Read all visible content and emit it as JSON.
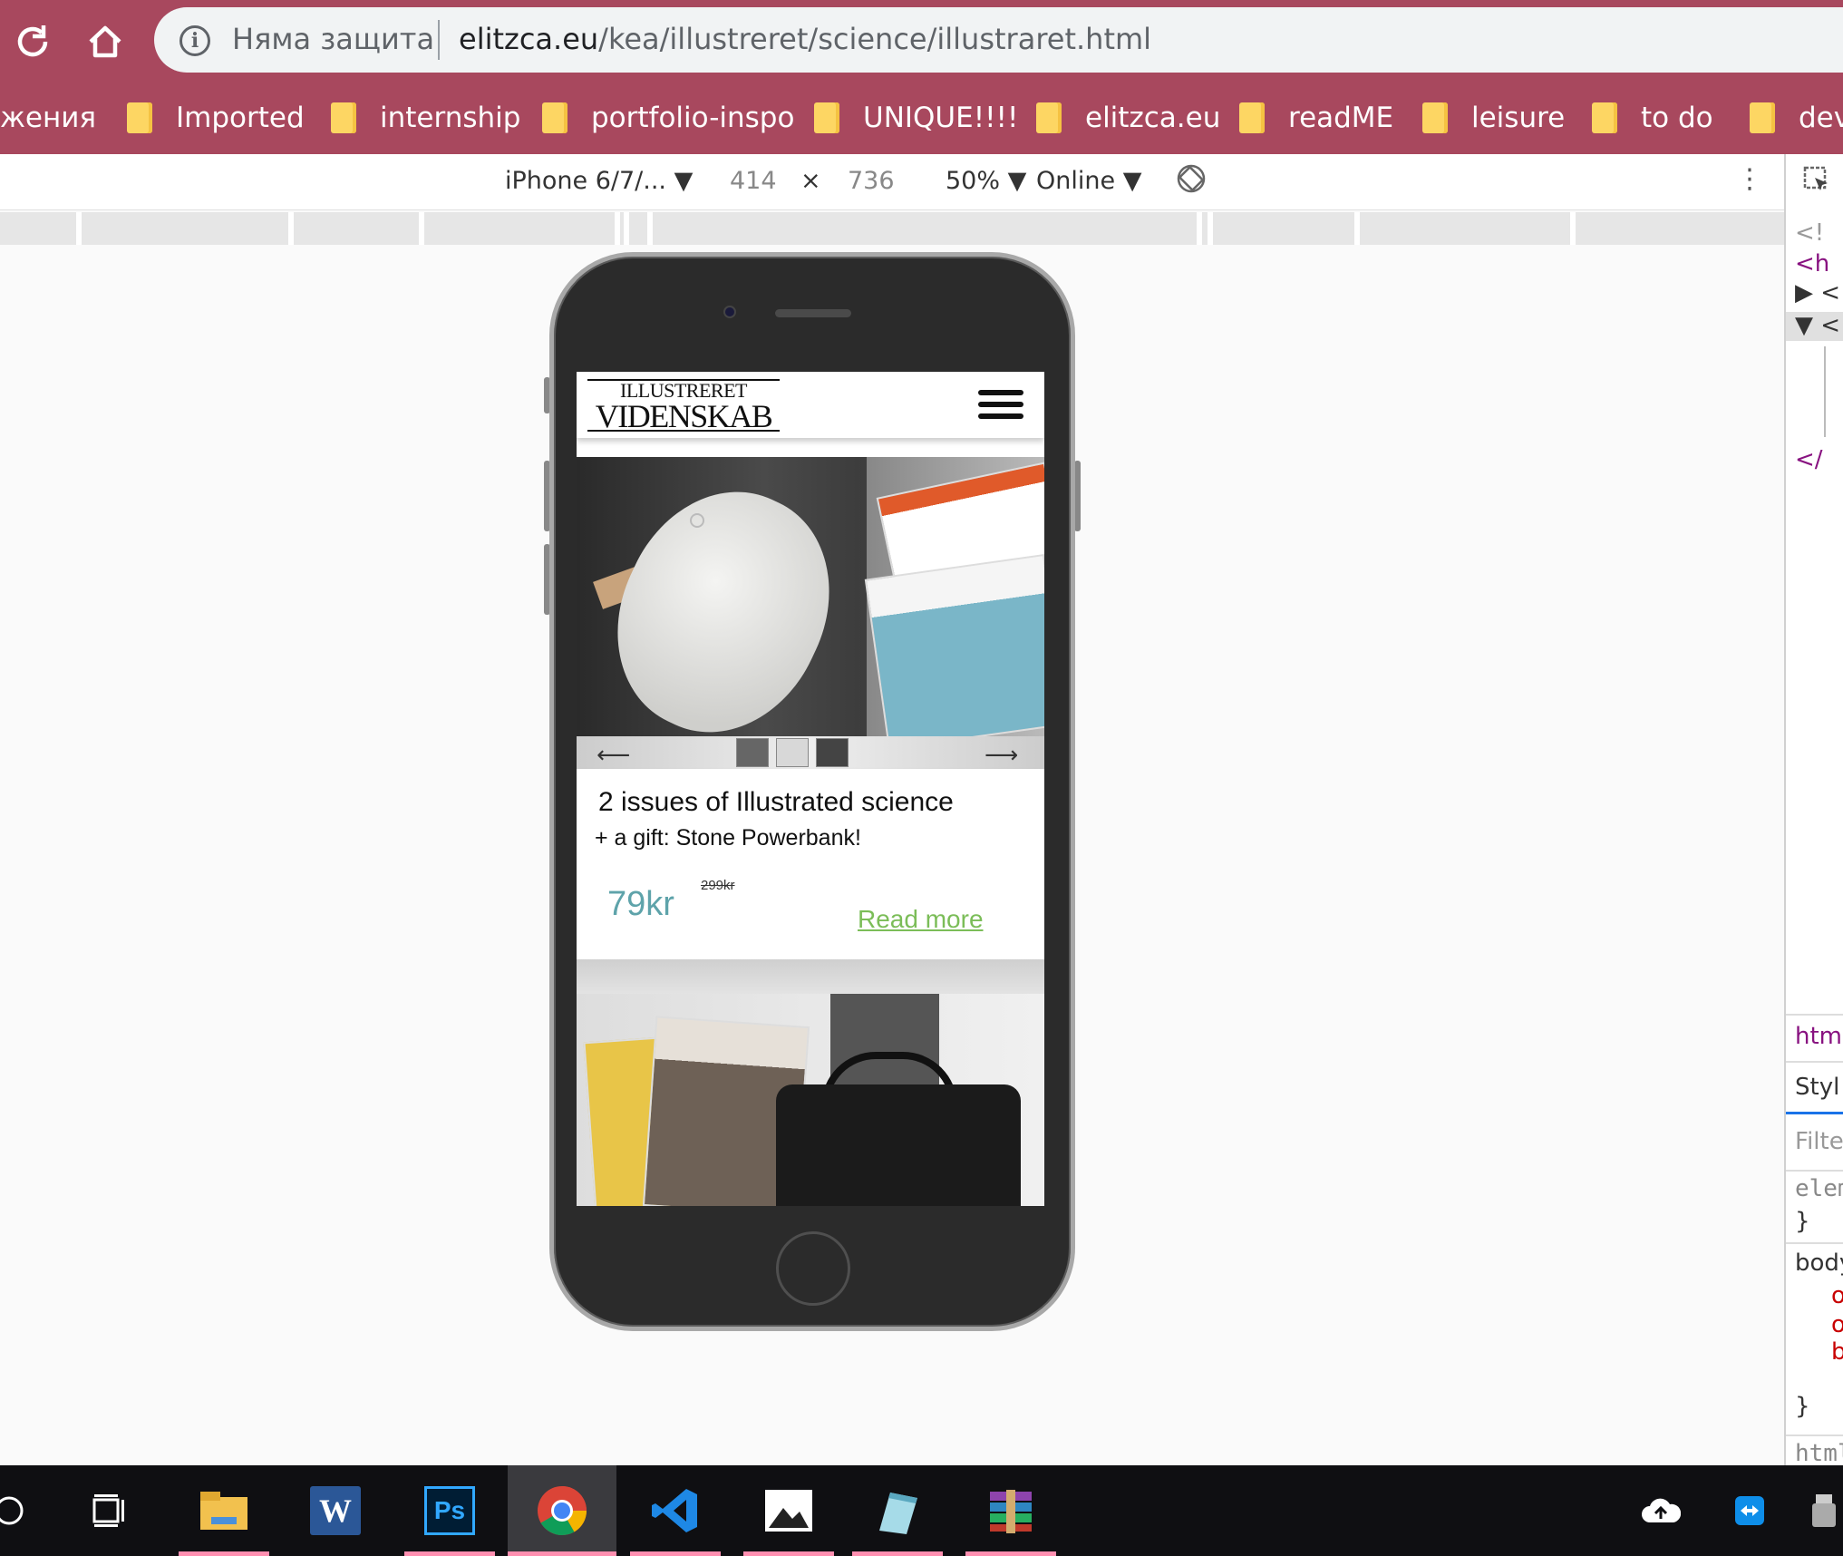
{
  "browser": {
    "security_label": "Няма защита",
    "url_host": "elitzca.eu",
    "url_path": "/kea/illustreret/science/illustraret.html"
  },
  "bookmarks": [
    "жения",
    "Imported",
    "internship",
    "portfolio-inspo",
    "UNIQUE!!!!",
    "elitzca.eu",
    "readME",
    "leisure",
    "to do",
    "dev"
  ],
  "device_toolbar": {
    "device": "iPhone 6/7/...",
    "width": "414",
    "times": "×",
    "height": "736",
    "zoom": "50%",
    "network": "Online"
  },
  "devtools": {
    "elements_lines": [
      "<!",
      "<h",
      "▶ <",
      "▼ <",
      "</"
    ],
    "breadcrumb": "htm",
    "styles_tab": "Styl",
    "filter_placeholder": "Filte",
    "rules": [
      "elem",
      "}",
      "body",
      "o",
      "o",
      "b",
      "}",
      "html"
    ]
  },
  "site": {
    "logo_line1": "ILLUSTRERET",
    "logo_line2": "VIDENSKAB",
    "offer_title": "2 issues of Illustrated science",
    "offer_subtitle": "+ a gift: Stone Powerbank!",
    "old_price": "299kr",
    "price": "79kr",
    "read_more": "Read more",
    "prev_arrow": "⟵",
    "next_arrow": "⟶"
  },
  "taskbar": {
    "apps": [
      "cortana-icon",
      "task-view-icon",
      "file-explorer-icon",
      "word-icon",
      "photoshop-icon",
      "chrome-icon",
      "vscode-icon",
      "photos-icon",
      "notepad-icon",
      "winrar-icon"
    ],
    "word_label": "W",
    "photoshop_label": "Ps"
  },
  "colors": {
    "chrome_frame": "#a8485e",
    "price_color": "#5ea3aa",
    "link_color": "#7bbd58"
  }
}
